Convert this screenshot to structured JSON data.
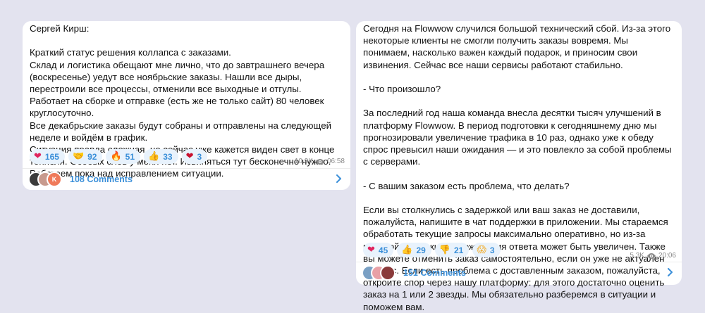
{
  "post1": {
    "text": "Сергей Кирш:\n\nКраткий статус решения коллапса с заказами.\nСклад и логистика обещают мне лично, что до завтрашнего вечера (воскресенье) уедут все ноябрьские заказы. Нашли все дыры, перестроили все процессы, отменили все выходные и отгулы. Работает на сборке и отправке (есть же не только сайт) 80 человек круглосуточно.\nВсе декабрьские заказы будут собраны и отправлены на следующей неделе и войдём в график.\nСитуация правда сложная, но сейчас уже кажется виден свет в конце тоннеля. Особых слов у меня нет. Извиняться тут бесконечно нужно.\nРаботаем пока над исправлением ситуации.",
    "reactions": [
      {
        "icon": "red-heart-icon",
        "emoji": "❤",
        "count": "165",
        "color": "#e0245e"
      },
      {
        "icon": "handshake-icon",
        "emoji": "🤝",
        "count": "92",
        "color": "#f2b33d"
      },
      {
        "icon": "fire-icon",
        "emoji": "🔥",
        "count": "51",
        "color": "#f26a1b"
      },
      {
        "icon": "thumbs-up-icon",
        "emoji": "👍",
        "count": "33",
        "color": "#f2b33d"
      },
      {
        "icon": "heart-on-fire-icon",
        "emoji": "❤",
        "count": "3",
        "color": "#c8102e"
      }
    ],
    "views": "10.9K",
    "time": "06:58",
    "comments_label": "108 Comments"
  },
  "post2": {
    "text": "Сегодня на Flowwow случился большой технический сбой. Из-за этого некоторые клиенты не смогли получить заказы вовремя. Мы понимаем, насколько важен каждый подарок, и приносим свои извинения. Сейчас все наши сервисы работают стабильно.\n\n- Что произошло?\n\nЗа последний год наша команда внесла десятки тысяч улучшений в платформу Flowwow. В период подготовки к сегодняшнему дню мы прогнозировали увеличение трафика в 10 раз, однако уже к обеду спрос превысил наши ожидания — и это повлекло за собой проблемы с серверами.\n\n- С вашим заказом есть проблема, что делать?\n\nЕсли вы столкнулись с задержкой или ваш заказ не доставили, пожалуйста, напишите в чат поддержки в приложении. Мы стараемся обработать текущие запросы максимально оперативно, но из-за высокой нагрузки срок ожидания ответа может быть увеличен. Также вы можете отменить заказ самостоятельно, если он уже не актуален для вас. Если есть проблема с доставленным заказом, пожалуйста, откройте спор через нашу платформу: для этого достаточно оценить заказ на 1 или 2 звезды. Мы обязательно разберемся в ситуации и поможем вам.",
    "reactions": [
      {
        "icon": "red-heart-icon",
        "emoji": "❤",
        "count": "45",
        "color": "#e0245e"
      },
      {
        "icon": "thumbs-up-icon",
        "emoji": "👍",
        "count": "29",
        "color": "#f2b33d"
      },
      {
        "icon": "thumbs-down-icon",
        "emoji": "👎",
        "count": "21",
        "color": "#f2b33d"
      },
      {
        "icon": "screaming-face-icon",
        "emoji": "😱",
        "count": "3",
        "color": "#f2b33d"
      }
    ],
    "views": "5.3K",
    "time": "20:06",
    "comments_label": "151 Comments"
  },
  "colors": {
    "accent": "#3a8fd9",
    "background": "#e3e3ef",
    "reaction_bg": "#e8f2fc"
  }
}
